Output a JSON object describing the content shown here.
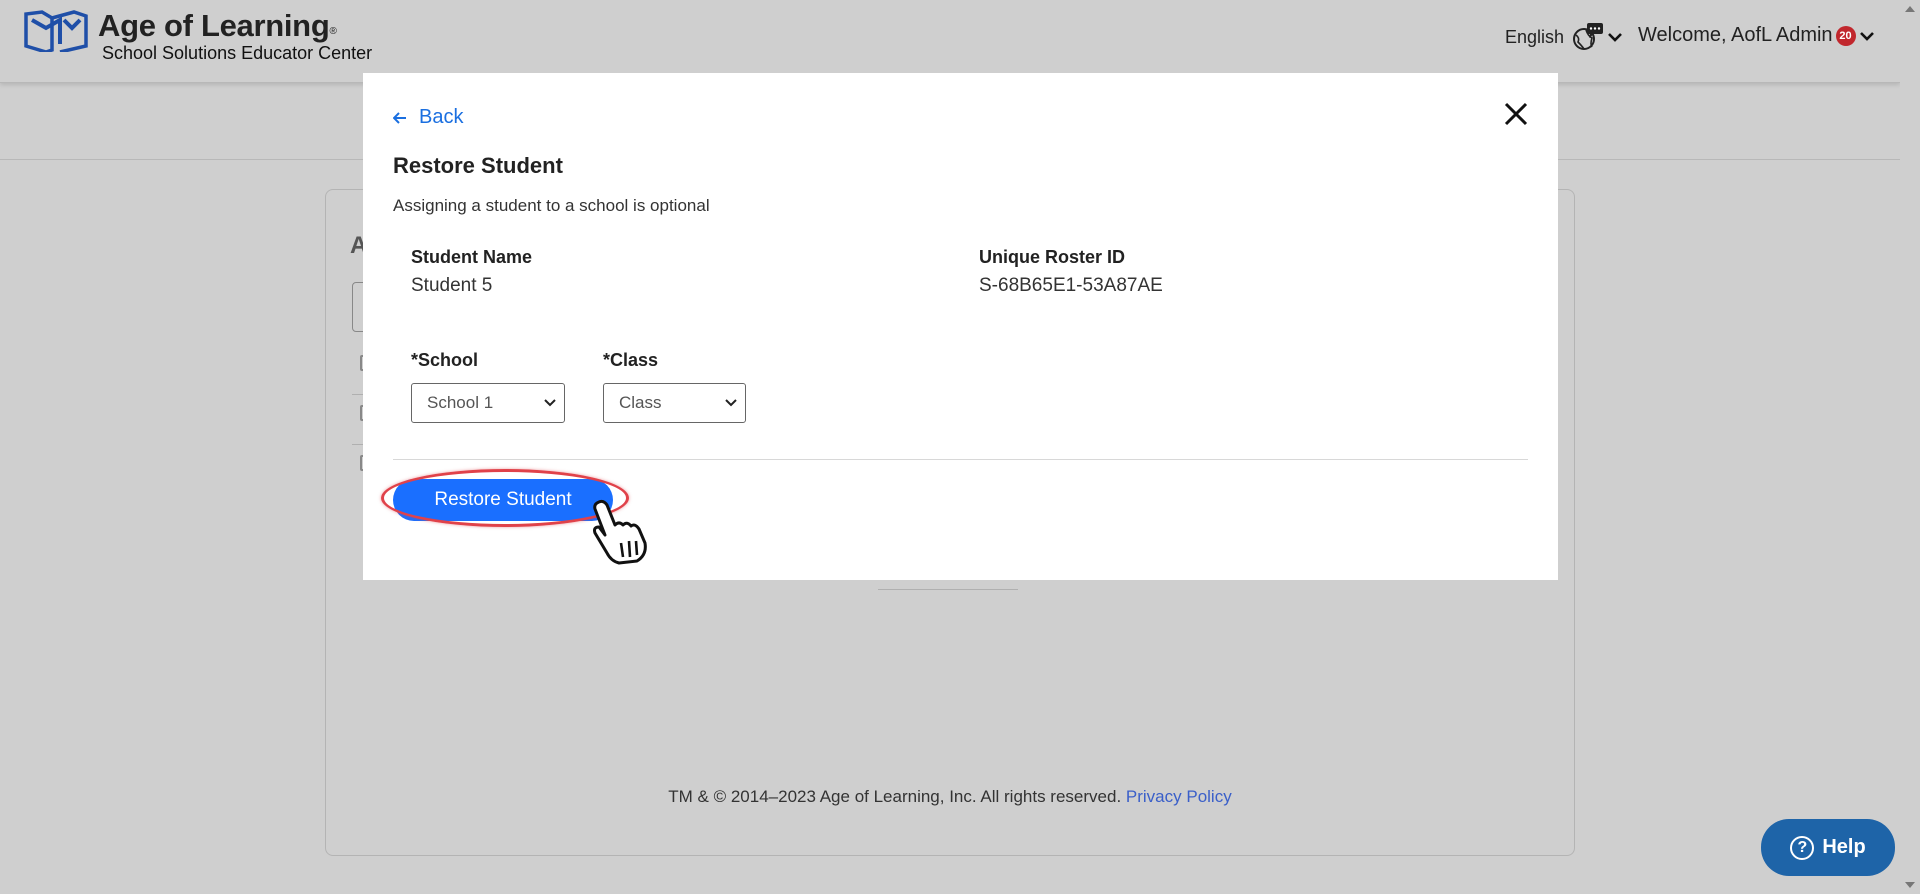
{
  "header": {
    "brand_title": "Age of Learning",
    "brand_trademark": "®",
    "brand_subtitle": "School Solutions Educator Center",
    "language_label": "English",
    "language_icon": "globe-chat-icon",
    "welcome_text": "Welcome, AofL Admin",
    "notification_count": "20"
  },
  "background": {
    "heading_partial": "A",
    "footer_text": "TM & © 2014–2023 Age of Learning, Inc. All rights reserved.",
    "privacy_link": "Privacy Policy"
  },
  "modal": {
    "back_label": "Back",
    "title": "Restore Student",
    "description": "Assigning a student to a school is optional",
    "student_name_label": "Student Name",
    "student_name_value": "Student 5",
    "roster_id_label": "Unique Roster ID",
    "roster_id_value": "S-68B65E1-53A87AE",
    "school_label": "*School",
    "school_selected": "School 1",
    "class_label": "*Class",
    "class_selected": "Class",
    "restore_button_label": "Restore Student"
  },
  "help": {
    "label": "Help",
    "icon_glyph": "?"
  },
  "colors": {
    "accent": "#1a6fff",
    "link": "#1a6fe0",
    "help": "#1e64a8",
    "badge": "#c1272d",
    "highlight": "#e0424a",
    "overlay": "#cfcfcf"
  }
}
